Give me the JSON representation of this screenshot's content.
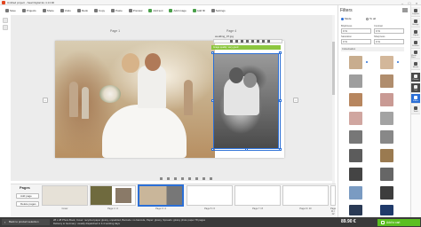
{
  "window": {
    "title": "Untitled project - Saal Digital Ex 4.14.90"
  },
  "toolbar": {
    "items": [
      {
        "label": "Save"
      },
      {
        "label": "Projects"
      },
      {
        "label": "Share"
      },
      {
        "label": "Undo"
      },
      {
        "label": "Redo"
      },
      {
        "label": "Copy"
      },
      {
        "label": "Paste"
      },
      {
        "label": "Preview"
      },
      {
        "label": "Add text"
      },
      {
        "label": "Add image"
      },
      {
        "label": "Add fill"
      },
      {
        "label": "Settings"
      }
    ]
  },
  "canvas": {
    "page_label_left": "Page 1",
    "page_label_right": "Page 4",
    "file_label": "wedding_07.jpg",
    "warning": "Image quality: very good"
  },
  "pages": {
    "title": "Pages",
    "add_label": "Add page",
    "delete_label": "Delete pages",
    "thumbs": [
      {
        "label": "Cover"
      },
      {
        "label": "Page 1 / 2"
      },
      {
        "label": "Page 3 / 4"
      },
      {
        "label": "Page 5 / 6"
      },
      {
        "label": "Page 7 / 8"
      },
      {
        "label": "Page 9 / 10"
      },
      {
        "label": "Page 11 / 12"
      }
    ]
  },
  "filters": {
    "title": "Filters",
    "radio_mode": "Mode",
    "radio_all": "To all",
    "brightness_label": "Brightness",
    "brightness_value": "0 %",
    "contrast_label": "Contrast",
    "contrast_value": "0 %",
    "saturation_label": "Saturation",
    "saturation_value": "0 %",
    "sharpness_label": "Sharpness",
    "sharpness_value": "0 %",
    "colorization_label": "Colourisation"
  },
  "sidebar": {
    "items": [
      {
        "label": "Layouts"
      },
      {
        "label": "Backgr."
      },
      {
        "label": "Clipart"
      },
      {
        "label": "Frames"
      },
      {
        "label": "Photo Print"
      },
      {
        "label": "Masks"
      },
      {
        "label": "Photos"
      },
      {
        "label": "Text"
      },
      {
        "label": "Filters"
      },
      {
        "label": "Tools"
      }
    ]
  },
  "footer": {
    "back_label": "Back to product selection",
    "info_line1": "28 x 28 Photo Book, Cover: recycled paper glossy, unpadded, Barcode: no barcode, Paper: glossy, Spreads: glossy photo paper 78 pages",
    "info_line2": "Delivery to Germany: usually dispatched in 3-4 working days",
    "price": "89.90 €",
    "cart_label": "Add to cart"
  },
  "colors": {
    "accent": "#2b6fd6",
    "brand": "#e2451f",
    "cart": "#5bbf21",
    "warning_bar": "#8cc63f"
  }
}
